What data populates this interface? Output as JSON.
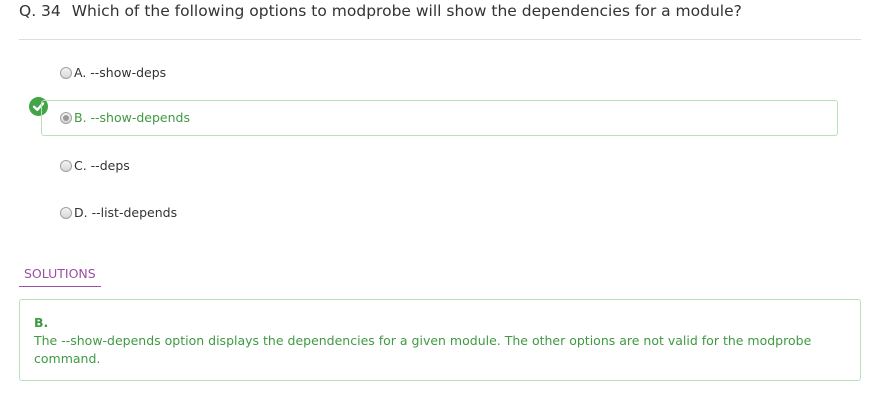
{
  "question": {
    "number": "Q. 34",
    "text": "Which of the following options to modprobe will show the dependencies for a module?"
  },
  "options": [
    {
      "label": "A. --show-deps",
      "correct": false,
      "selected": false
    },
    {
      "label": "B. --show-depends",
      "correct": true,
      "selected": true
    },
    {
      "label": "C. --deps",
      "correct": false,
      "selected": false
    },
    {
      "label": "D. --list-depends",
      "correct": false,
      "selected": false
    }
  ],
  "solutions": {
    "tab_label": "SOLUTIONS",
    "answer": "B.",
    "explanation": "The --show-depends option displays the dependencies for a given module. The other options are not valid for the modprobe command."
  },
  "colors": {
    "correct": "#3f9a43",
    "accent": "#9c4ea8",
    "border_correct": "#b7e2b9"
  },
  "icons": {
    "correct_marker": "check-circle-icon"
  }
}
